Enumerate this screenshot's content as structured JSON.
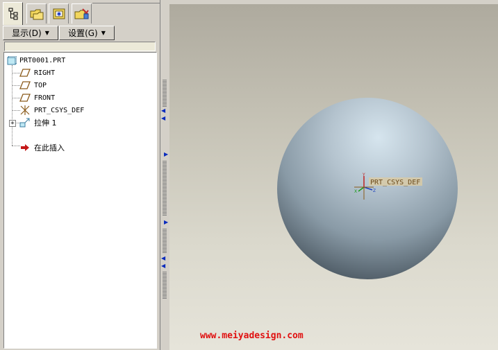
{
  "tabs": [
    {
      "icon": "model-tree-icon",
      "active": true
    },
    {
      "icon": "folder-browser-icon",
      "active": false
    },
    {
      "icon": "favorites-icon",
      "active": false
    },
    {
      "icon": "connections-icon",
      "active": false
    }
  ],
  "menu": {
    "show_label": "显示(D)",
    "settings_label": "设置(G)"
  },
  "tree": {
    "root": "PRT0001.PRT",
    "items": [
      {
        "label": "RIGHT",
        "icon": "datum-plane-icon"
      },
      {
        "label": "TOP",
        "icon": "datum-plane-icon"
      },
      {
        "label": "FRONT",
        "icon": "datum-plane-icon"
      },
      {
        "label": "PRT_CSYS_DEF",
        "icon": "coordinate-system-icon"
      },
      {
        "label": "拉伸 1",
        "icon": "extrude-feature-icon"
      }
    ],
    "insert_here": "在此插入"
  },
  "viewport": {
    "csys_label": "PRT_CSYS_DEF",
    "axis_x": "X",
    "axis_y": "Y",
    "axis_z": "Z"
  },
  "watermark": "www.meiyadesign.com",
  "colors": {
    "sphere": "#a6b3bd",
    "background_top": "#aeaa9e",
    "background_bottom": "#e6e4da",
    "watermark": "#e01010",
    "csys_label_bg": "#d8caa6"
  }
}
